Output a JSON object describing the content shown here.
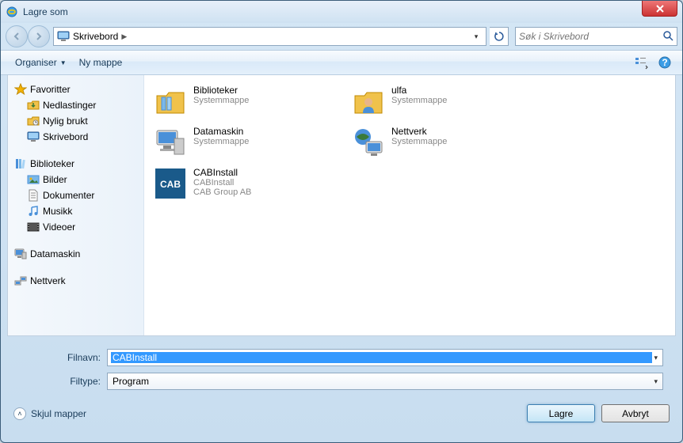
{
  "window": {
    "title": "Lagre som"
  },
  "nav": {
    "breadcrumb": "Skrivebord",
    "search_placeholder": "Søk i Skrivebord"
  },
  "toolbar": {
    "organize": "Organiser",
    "new_folder": "Ny mappe"
  },
  "sidebar": {
    "favorites": {
      "label": "Favoritter",
      "items": [
        {
          "key": "downloads",
          "label": "Nedlastinger"
        },
        {
          "key": "recent",
          "label": "Nylig brukt"
        },
        {
          "key": "desktop",
          "label": "Skrivebord"
        }
      ]
    },
    "libraries": {
      "label": "Biblioteker",
      "items": [
        {
          "key": "pictures",
          "label": "Bilder"
        },
        {
          "key": "documents",
          "label": "Dokumenter"
        },
        {
          "key": "music",
          "label": "Musikk"
        },
        {
          "key": "videos",
          "label": "Videoer"
        }
      ]
    },
    "computer": {
      "label": "Datamaskin"
    },
    "network": {
      "label": "Nettverk"
    }
  },
  "content": {
    "items": [
      {
        "name": "Biblioteker",
        "sub1": "Systemmappe",
        "sub2": ""
      },
      {
        "name": "ulfa",
        "sub1": "Systemmappe",
        "sub2": ""
      },
      {
        "name": "Datamaskin",
        "sub1": "Systemmappe",
        "sub2": ""
      },
      {
        "name": "Nettverk",
        "sub1": "Systemmappe",
        "sub2": ""
      },
      {
        "name": "CABInstall",
        "sub1": "CABInstall",
        "sub2": "CAB Group AB"
      }
    ]
  },
  "fields": {
    "filename_label": "Filnavn:",
    "filename_value": "CABInstall",
    "filetype_label": "Filtype:",
    "filetype_value": "Program"
  },
  "footer": {
    "hide_folders": "Skjul mapper",
    "save": "Lagre",
    "cancel": "Avbryt"
  }
}
